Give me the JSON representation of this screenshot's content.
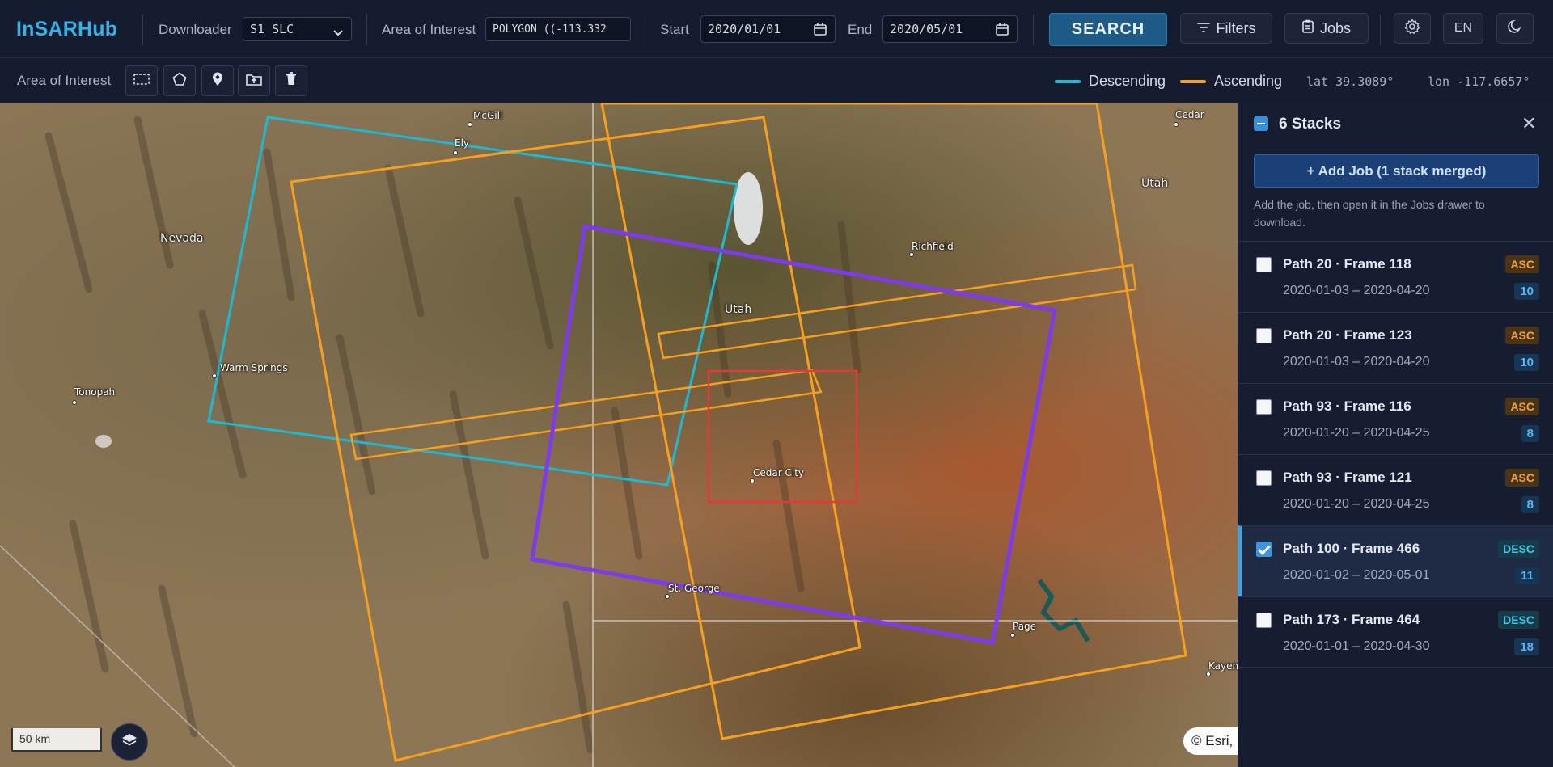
{
  "app": {
    "title": "InSARHub"
  },
  "topbar": {
    "downloader_label": "Downloader",
    "downloader_value": "S1_SLC",
    "aoi_label": "Area of Interest",
    "aoi_value": "POLYGON ((-113.332",
    "start_label": "Start",
    "start_value": "2020/01/01",
    "end_label": "End",
    "end_value": "2020/05/01",
    "search_label": "SEARCH",
    "filters_label": "Filters",
    "jobs_label": "Jobs",
    "lang_label": "EN"
  },
  "toolbar": {
    "aoi_label": "Area of Interest",
    "legend_descending": "Descending",
    "legend_ascending": "Ascending",
    "lat": "lat 39.3089°",
    "lon": "lon -117.6657°"
  },
  "colors": {
    "descending": "#1fb8d2",
    "ascending": "#f5a020",
    "selected": "#7d3ce8",
    "aoi": "#e23a3a",
    "accent": "#35b3e8"
  },
  "map": {
    "scale_label": "50 km",
    "attribution": "© Esri,",
    "labels": {
      "mcgill": "McGill",
      "ely": "Ely",
      "nevada": "Nevada",
      "warm_springs": "Warm Springs",
      "tonopah": "Tonopah",
      "utah_center": "Utah",
      "utah_east": "Utah",
      "cedar": "Cedar",
      "richfield": "Richfield",
      "cedar_city": "Cedar City",
      "st_george": "St. George",
      "page": "Page",
      "kayenta": "Kayen"
    }
  },
  "panel": {
    "title": "6 Stacks",
    "add_job_label": "+ Add Job (1 stack merged)",
    "hint": "Add the job, then open it in the Jobs drawer to download.",
    "stacks": [
      {
        "name": "Path 20 · Frame 118",
        "dates": "2020-01-03 – 2020-04-20",
        "dir": "ASC",
        "count": "10",
        "checked": false
      },
      {
        "name": "Path 20 · Frame 123",
        "dates": "2020-01-03 – 2020-04-20",
        "dir": "ASC",
        "count": "10",
        "checked": false
      },
      {
        "name": "Path 93 · Frame 116",
        "dates": "2020-01-20 – 2020-04-25",
        "dir": "ASC",
        "count": "8",
        "checked": false
      },
      {
        "name": "Path 93 · Frame 121",
        "dates": "2020-01-20 – 2020-04-25",
        "dir": "ASC",
        "count": "8",
        "checked": false
      },
      {
        "name": "Path 100 · Frame 466",
        "dates": "2020-01-02 – 2020-05-01",
        "dir": "DESC",
        "count": "11",
        "checked": true
      },
      {
        "name": "Path 173 · Frame 464",
        "dates": "2020-01-01 – 2020-04-30",
        "dir": "DESC",
        "count": "18",
        "checked": false
      }
    ]
  }
}
